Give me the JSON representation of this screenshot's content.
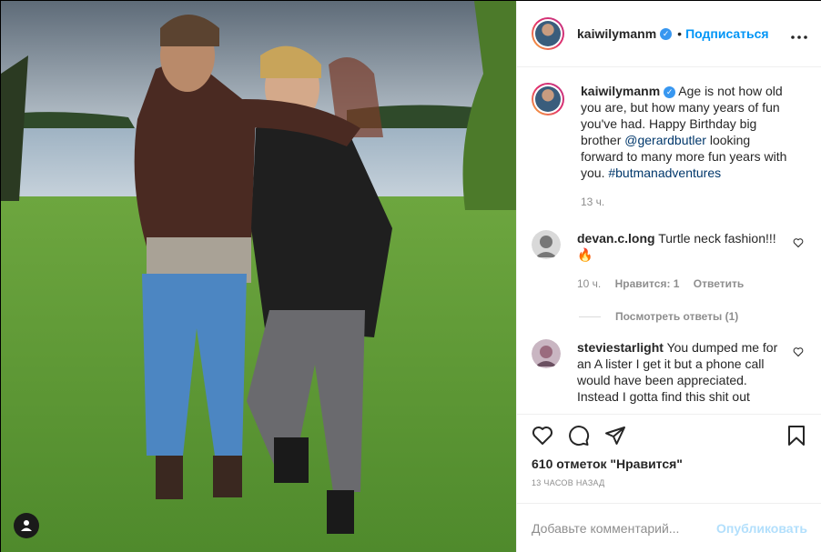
{
  "post": {
    "username": "kaiwilymanm",
    "verified_glyph": "✓",
    "dot": "•",
    "follow_label": "Подписаться",
    "more_label": "•••",
    "caption": {
      "username": "kaiwilymanm",
      "text_before": " Age is not how old you are, but how many years of fun you've had. Happy Birthday big brother ",
      "mention": "@gerardbutler",
      "text_middle": " looking forward to many more fun years with you. ",
      "hashtag": "#butmanadventures",
      "age": "13 ч."
    },
    "comments": [
      {
        "username": "devan.c.long",
        "text": " Turtle neck fashion!!!🔥",
        "age": "10 ч.",
        "likes": "Нравится: 1",
        "reply": "Ответить",
        "view_replies": "Посмотреть ответы (1)"
      },
      {
        "username": "steviestarlight",
        "text": " You dumped me for an A lister I get it but a phone call would have been appreciated. Instead I gotta find this shit out"
      }
    ],
    "likes_text": "610 отметок \"Нравится\"",
    "timestamp": "13 часов назад",
    "comment_placeholder": "Добавьте комментарий...",
    "publish_label": "Опубликовать"
  },
  "icons": {
    "like": "heart-icon",
    "comment": "comment-icon",
    "share": "share-icon",
    "save": "bookmark-icon",
    "more": "more-icon",
    "user_tag": "user-icon"
  },
  "colors": {
    "accent": "#0095f6",
    "publish_disabled": "#b2dffc",
    "verified": "#3897f0"
  }
}
